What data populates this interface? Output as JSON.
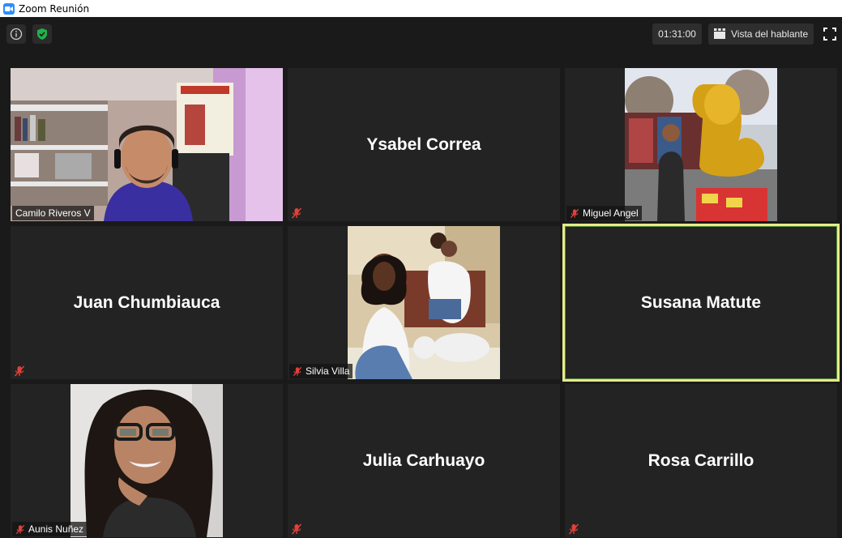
{
  "window": {
    "title": "Zoom Reunión"
  },
  "toolbar": {
    "timer": "01:31:00",
    "speaker_view_label": "Vista del hablante"
  },
  "participants": [
    {
      "name": "Camilo Riveros V",
      "muted": false,
      "video": true
    },
    {
      "name": "Ysabel Correa",
      "muted": true,
      "video": false
    },
    {
      "name": "Miguel Angel",
      "muted": true,
      "video": true
    },
    {
      "name": "Juan Chumbiauca",
      "muted": true,
      "video": false
    },
    {
      "name": "Silvia Villa",
      "muted": true,
      "video": true
    },
    {
      "name": "Susana Matute",
      "muted": false,
      "video": false,
      "active_speaker": true
    },
    {
      "name": "Aunis Nuñez",
      "muted": true,
      "video": true
    },
    {
      "name": "Julia Carhuayo",
      "muted": true,
      "video": false
    },
    {
      "name": "Rosa Carrillo",
      "muted": true,
      "video": false
    }
  ],
  "colors": {
    "accent": "#2d8cff",
    "mute": "#e0413a",
    "active_border": "#e6eb8a",
    "tile_bg": "#232323",
    "app_bg": "#1a1a1a"
  },
  "icons": {
    "info": "info-icon",
    "shield": "shield-check-icon",
    "speaker_view": "grid-icon",
    "fullscreen": "fullscreen-icon",
    "mute": "mic-muted-icon"
  }
}
